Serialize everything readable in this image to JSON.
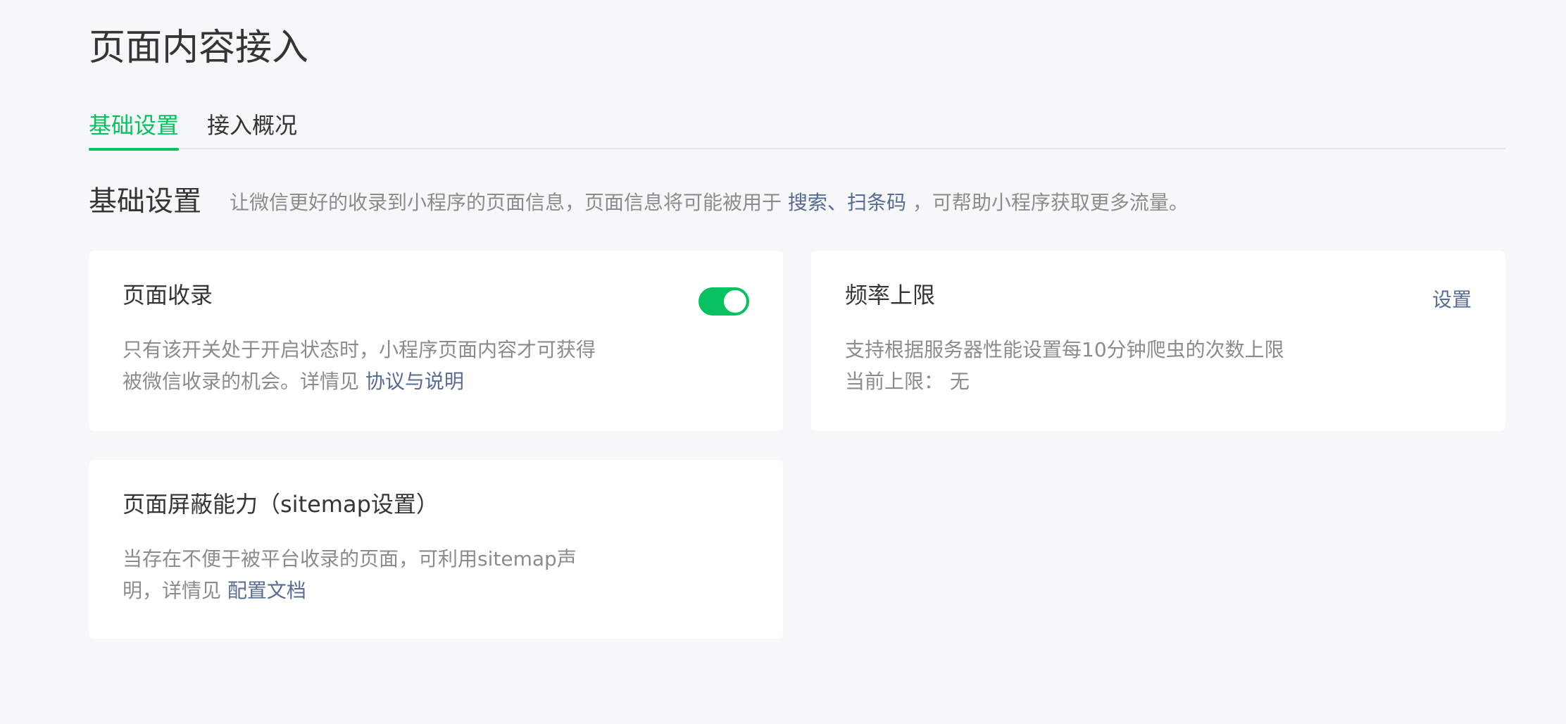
{
  "page_title": "页面内容接入",
  "tabs": [
    {
      "label": "基础设置",
      "active": true
    },
    {
      "label": "接入概况",
      "active": false
    }
  ],
  "section": {
    "title": "基础设置",
    "desc_before": "让微信更好的收录到小程序的页面信息，页面信息将可能被用于 ",
    "link_search": "搜索",
    "separator": "、",
    "link_scan": "扫条码",
    "desc_after": " ，可帮助小程序获取更多流量。"
  },
  "card_index": {
    "title": "页面收录",
    "toggle_on": true,
    "text_line1": "只有该开关处于开启状态时，小程序页面内容才可获得",
    "text_line2": "被微信收录的机会。详情见 ",
    "link": "协议与说明"
  },
  "card_rate": {
    "title": "频率上限",
    "action": "设置",
    "text_line1": "支持根据服务器性能设置每10分钟爬虫的次数上限",
    "limit_label": "当前上限：",
    "limit_value": "无"
  },
  "card_sitemap": {
    "title": "页面屏蔽能力（sitemap设置）",
    "text_line1": "当存在不便于被平台收录的页面，可利用sitemap声",
    "text_line2": "明，详情见 ",
    "link": "配置文档"
  },
  "colors": {
    "accent": "#07c160",
    "link": "#576b95",
    "muted_text": "#8c8c8c",
    "background": "#f6f7f9"
  }
}
